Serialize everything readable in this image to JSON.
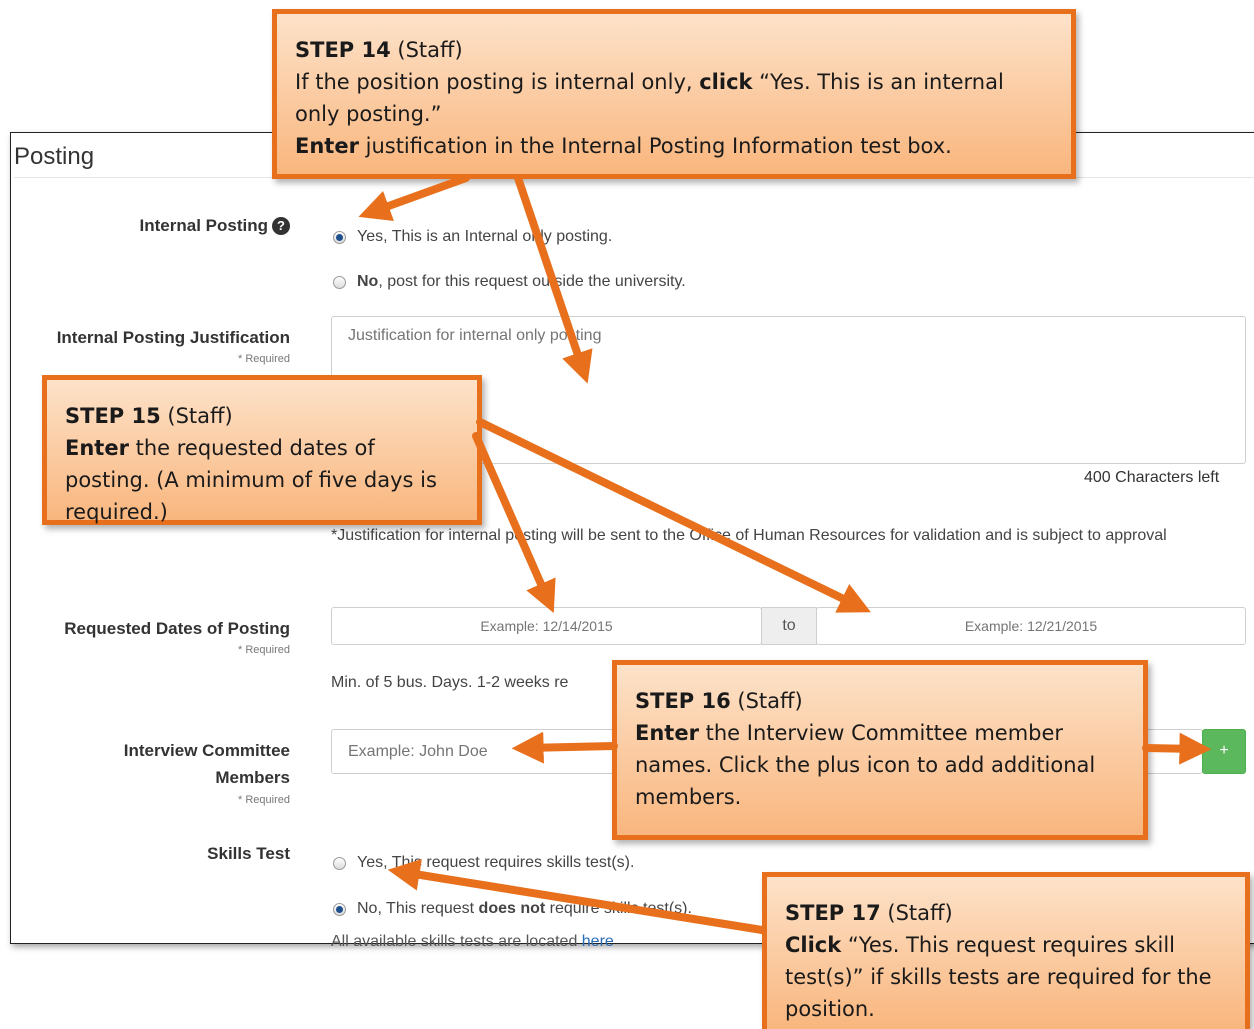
{
  "section": {
    "title": "Posting"
  },
  "internal_posting": {
    "label": "Internal Posting",
    "help_icon": "question-circle-icon",
    "yes_text": "Yes, This is an Internal only posting.",
    "no_bold": "No",
    "no_text": ", post for this request outside the university.",
    "selected": "yes"
  },
  "justification": {
    "label": "Internal Posting Justification",
    "required": "* Required",
    "placeholder": "Justification for internal only posting",
    "chars_left": "400 Characters left",
    "note": "*Justification for internal posting will be sent to the Office of Human Resources for validation and is subject to approval"
  },
  "dates": {
    "label": "Requested Dates of Posting",
    "required": "* Required",
    "start_placeholder": "Example: 12/14/2015",
    "separator": "to",
    "end_placeholder": "Example: 12/21/2015",
    "hint": "Min. of 5 bus. Days. 1-2 weeks re"
  },
  "committee": {
    "label_line1": "Interview Committee",
    "label_line2": "Members",
    "required": "* Required",
    "placeholder": "Example: John Doe",
    "add_button": "+"
  },
  "skills_test": {
    "label": "Skills Test",
    "yes_text": "Yes, This request requires skills test(s).",
    "no_prefix": "No, This request ",
    "no_bold": "does not",
    "no_suffix": " require skills test(s).",
    "selected": "no",
    "footer_text": "All available skills tests are located ",
    "footer_link": "here"
  },
  "callouts": {
    "step14": {
      "step": "STEP 14",
      "role": " (Staff)",
      "line1": "If the position posting is internal only, ",
      "line1_bold": "click",
      "line1_rest": " “Yes. This is an internal only posting.”",
      "line2_bold": "Enter",
      "line2_rest": " justification in the Internal Posting Information test box."
    },
    "step15": {
      "step": "STEP 15",
      "role": " (Staff)",
      "bold": "Enter",
      "rest": " the requested dates of posting. (A minimum of five days is required.)"
    },
    "step16": {
      "step": "STEP 16",
      "role": " (Staff)",
      "bold": "Enter",
      "rest": " the Interview Committee member names. Click the plus icon to add additional members."
    },
    "step17": {
      "step": "STEP 17",
      "role": " (Staff)",
      "bold": "Click",
      "rest": " “Yes. This request requires skill test(s)” if skills tests are required for the position."
    }
  },
  "colors": {
    "callout_border": "#e8701c",
    "arrow": "#e8701c",
    "add_button": "#5cb85c",
    "link": "#2a6bb7"
  }
}
